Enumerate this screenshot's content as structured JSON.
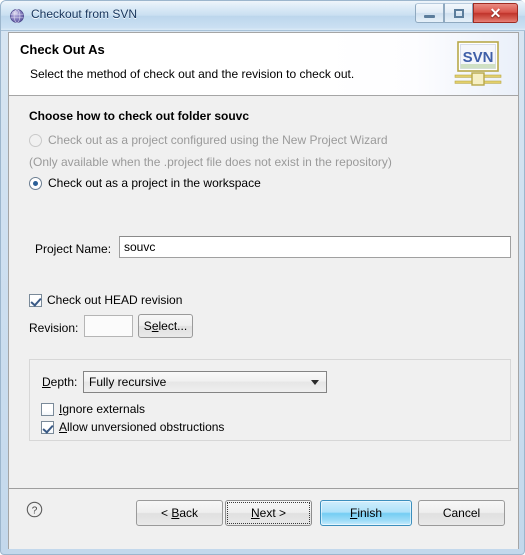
{
  "window": {
    "title": "Checkout from SVN",
    "icon": "svn-globe-icon",
    "controls": {
      "minimize": "Minimize",
      "maximize": "Maximize",
      "close": "Close",
      "close_glyph": "✕"
    }
  },
  "header": {
    "title": "Check Out As",
    "description": "Select the method of check out and the revision to check out.",
    "logo_text": "SVN",
    "logo_name": "svn-banner-logo"
  },
  "page": {
    "group_label": "Choose how to check out folder souvc",
    "radio_wizard": {
      "label": "Check out as a project configured using the New Project Wizard",
      "checked": false,
      "enabled": false
    },
    "wizard_hint": "(Only available when the .project file does not exist in the repository)",
    "radio_workspace": {
      "label": "Check out as a project in the workspace",
      "checked": true,
      "enabled": true
    },
    "project_name": {
      "label": "Project Name:",
      "value": "souvc",
      "placeholder": ""
    },
    "head_revision": {
      "label": "Check out HEAD revision",
      "checked": true
    },
    "revision": {
      "label": "Revision:",
      "value": "",
      "placeholder": "",
      "select_button": "Select...",
      "select_button_mnemonic": "e"
    },
    "depth_group": {
      "depth_label": "Depth:",
      "depth_label_mnemonic": "D",
      "depth_value": "Fully recursive",
      "depth_options": [
        "Fully recursive"
      ],
      "ignore_externals": {
        "label": "Ignore externals",
        "mnemonic": "I",
        "checked": false
      },
      "allow_unversioned": {
        "label": "Allow unversioned obstructions",
        "mnemonic": "A",
        "checked": true
      }
    }
  },
  "buttonbar": {
    "help": "?",
    "help_name": "help-icon",
    "back": "< Back",
    "back_mnemonic": "B",
    "next": "Next >",
    "next_mnemonic": "N",
    "finish": "Finish",
    "finish_mnemonic": "F",
    "cancel": "Cancel"
  },
  "colors": {
    "titlebar_text": "#17355c",
    "close_button": "#c0342b",
    "default_button": "#74cdf3",
    "dialog_background": "#f0f0f0",
    "disabled_text": "#9a9a9a",
    "radio_dot": "#2b5f97"
  }
}
